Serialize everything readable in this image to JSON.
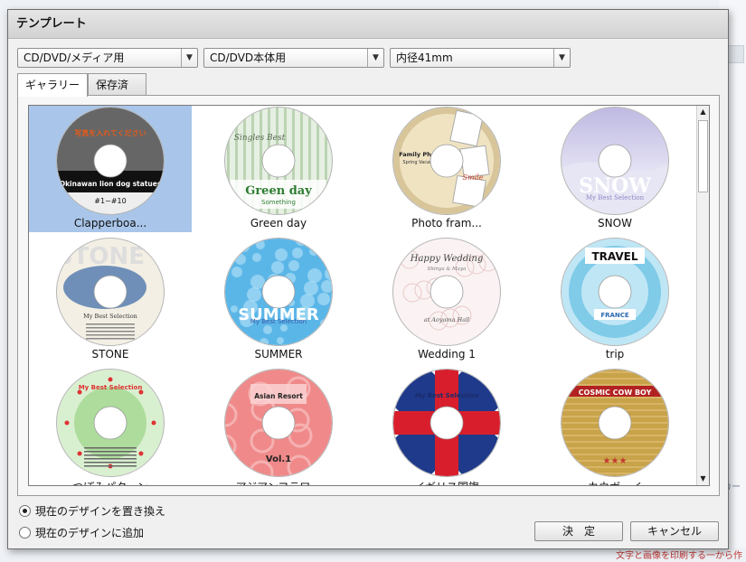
{
  "dialog": {
    "title": "テンプレート"
  },
  "selects": [
    {
      "value": "CD/DVD/メディア用"
    },
    {
      "value": "CD/DVD本体用"
    },
    {
      "value": "内径41mm"
    }
  ],
  "tabs": [
    {
      "label": "ギャラリー",
      "active": true
    },
    {
      "label": "保存済み",
      "active": false
    }
  ],
  "gallery": {
    "items": [
      {
        "label": "Clapperboa...",
        "selected": true,
        "theme": "clapper",
        "text1": "写真を入れてください",
        "text2": "Okinawan lion dog statues",
        "text3": "#1~#10",
        "colors": [
          "#666666",
          "#111111",
          "#ffffff"
        ]
      },
      {
        "label": "Green day",
        "selected": false,
        "theme": "greenday",
        "text1": "Singles Best",
        "text2": "Green day",
        "text3": "Something",
        "colors": [
          "#e6f0e2",
          "#9fbf94",
          "#2e7d32"
        ]
      },
      {
        "label": "Photo fram...",
        "selected": false,
        "theme": "photoframe",
        "text1": "Family Photo",
        "text2": "Spring Vacation",
        "text3": "Smile",
        "colors": [
          "#d8c69a",
          "#efe3c2",
          "#c0392b"
        ]
      },
      {
        "label": "SNOW",
        "selected": false,
        "theme": "snow",
        "text1": "SNOW",
        "text2": "My Best Selection",
        "text3": "",
        "colors": [
          "#c9c6e6",
          "#8f89c7",
          "#ffffff"
        ]
      },
      {
        "label": "STONE",
        "selected": false,
        "theme": "stone",
        "text1": "STONE",
        "text2": "My Best Selection",
        "text3": "",
        "colors": [
          "#f3efe4",
          "#6f8fb8",
          "#dddddd"
        ]
      },
      {
        "label": "SUMMER",
        "selected": false,
        "theme": "summer",
        "text1": "SUMMER",
        "text2": "My Best Selection",
        "text3": "",
        "colors": [
          "#5bb6e8",
          "#b7e3f7",
          "#ffffff"
        ]
      },
      {
        "label": "Wedding 1",
        "selected": false,
        "theme": "wedding",
        "text1": "Happy Wedding",
        "text2": "Shinya & Maya",
        "text3": "at Aoyama Hall",
        "colors": [
          "#fbf3f3",
          "#e8c8c8",
          "#444444"
        ]
      },
      {
        "label": "trip",
        "selected": false,
        "theme": "trip",
        "text1": "TRAVEL",
        "text2": "FRANCE",
        "text3": "",
        "colors": [
          "#bfe6f5",
          "#7fcbe8",
          "#111111"
        ]
      },
      {
        "label": "つぼみパターン",
        "selected": false,
        "theme": "bud",
        "text1": "My Best Selection",
        "text2": "",
        "text3": "",
        "colors": [
          "#d9f0d0",
          "#8fcf7a",
          "#d33"
        ]
      },
      {
        "label": "アジアンフラワー",
        "selected": false,
        "theme": "asian",
        "text1": "Asian Resort",
        "text2": "Vol.1",
        "text3": "",
        "colors": [
          "#f08a8a",
          "#f6b1b1",
          "#222222"
        ]
      },
      {
        "label": "イギリス国旗",
        "selected": false,
        "theme": "uk",
        "text1": "My Best Selection",
        "text2": "",
        "text3": "",
        "colors": [
          "#1f3a8a",
          "#d81e2c",
          "#ffffff"
        ]
      },
      {
        "label": "カウボーイ",
        "selected": false,
        "theme": "cowboy",
        "text1": "COSMIC COW BOY",
        "text2": "★★★",
        "text3": "",
        "colors": [
          "#c9a34a",
          "#e3c27a",
          "#c0392b"
        ]
      }
    ]
  },
  "options": [
    {
      "label": "現在のデザインを置き換え",
      "checked": true
    },
    {
      "label": "現在のデザインに追加",
      "checked": false
    }
  ],
  "buttons": {
    "ok": "決　定",
    "cancel": "キャンセル"
  },
  "background": {
    "side_text": "カー",
    "bottom_text": "文字と画像を印刷する一から作"
  }
}
